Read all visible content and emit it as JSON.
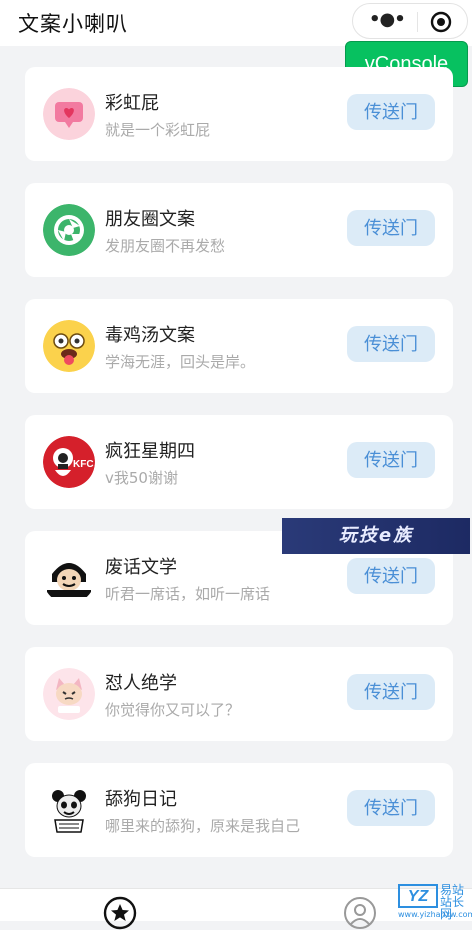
{
  "header": {
    "title": "文案小喇叭",
    "more_icon": "more-dots-icon",
    "close_icon": "target-circle-icon"
  },
  "vconsole": {
    "label": "vConsole",
    "color": "#07c160"
  },
  "button_label": "传送门",
  "items": [
    {
      "name": "彩虹屁",
      "desc": "就是一个彩虹屁",
      "icon": "heart-message-icon"
    },
    {
      "name": "朋友圈文案",
      "desc": "发朋友圈不再发愁",
      "icon": "camera-shutter-icon"
    },
    {
      "name": "毒鸡汤文案",
      "desc": "学海无涯，回头是岸。",
      "icon": "tongue-face-icon"
    },
    {
      "name": "疯狂星期四",
      "desc": "v我50谢谢",
      "icon": "kfc-logo-icon"
    },
    {
      "name": "废话文学",
      "desc": "听君一席话，如听一席话",
      "icon": "meme-face-icon"
    },
    {
      "name": "怼人绝学",
      "desc": "你觉得你又可以了？",
      "icon": "meme-cat-icon"
    },
    {
      "name": "舔狗日记",
      "desc": "哪里来的舔狗，原来是我自己",
      "icon": "meme-panda-icon"
    }
  ],
  "watermark": {
    "banner": "玩技e族",
    "logo": "YZ",
    "logo_cn": "易站\n站长网",
    "url": "www.yizhanzw.com"
  },
  "tabbar": {
    "home_icon": "star-circle-icon",
    "me_icon": "user-circle-icon"
  }
}
